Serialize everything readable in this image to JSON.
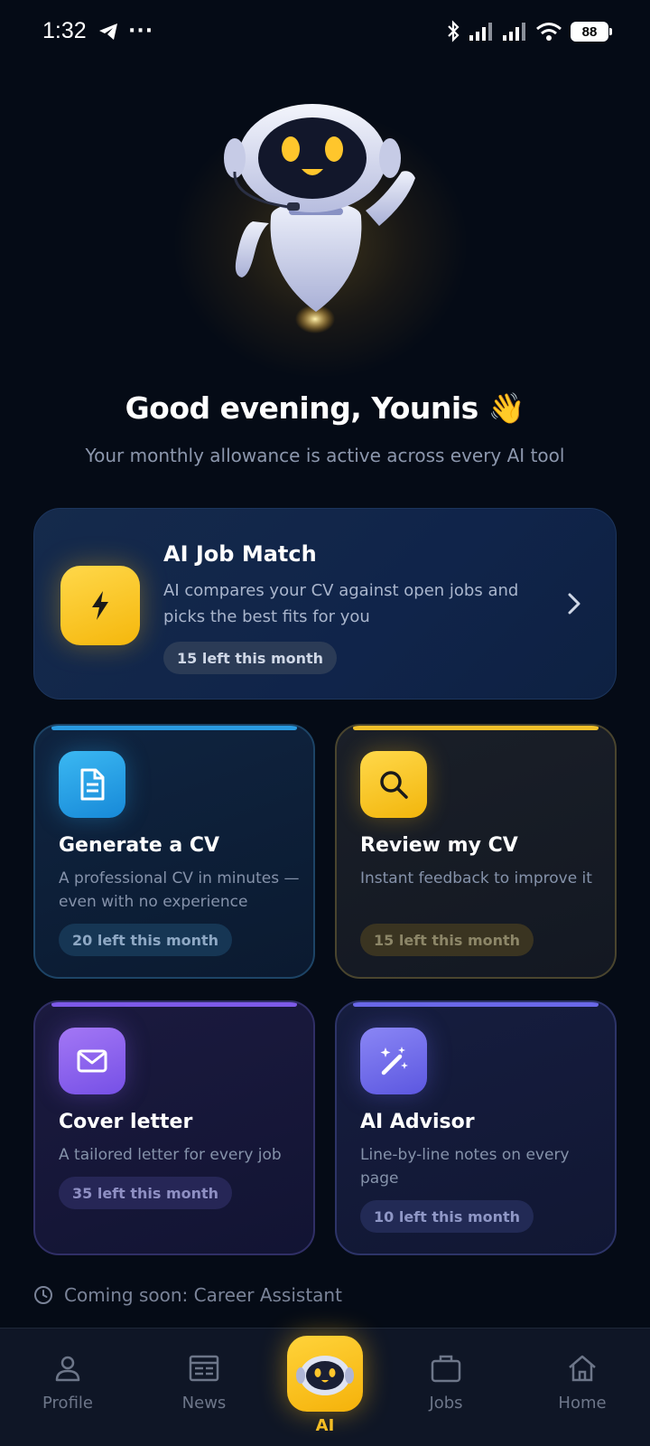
{
  "status_bar": {
    "time": "1:32",
    "more": "···",
    "battery": "88"
  },
  "hero": {
    "greeting": "Good evening, Younis 👋",
    "subtitle": "Your monthly allowance is active across every AI tool"
  },
  "featured": {
    "title": "AI Job Match",
    "description": "AI compares your CV against open jobs and picks the best fits for you",
    "badge": "15 left this month",
    "icon": "lightning-icon"
  },
  "tools": [
    {
      "title": "Generate a CV",
      "description": "A professional CV in minutes — even with no experience",
      "badge": "20 left this month",
      "icon": "document-icon",
      "color": "#2a9ae0"
    },
    {
      "title": "Review my CV",
      "description": "Instant feedback to improve it",
      "badge": "15 left this month",
      "icon": "search-icon",
      "color": "#f1c02a"
    },
    {
      "title": "Cover letter",
      "description": "A tailored letter for every job",
      "badge": "35 left this month",
      "icon": "envelope-icon",
      "color": "#7d5ae8"
    },
    {
      "title": "AI Advisor",
      "description": "Line-by-line notes on every page",
      "badge": "10 left this month",
      "icon": "magic-wand-icon",
      "color": "#6a68e8"
    }
  ],
  "coming_soon": "Coming soon: Career Assistant",
  "nav": {
    "profile": "Profile",
    "news": "News",
    "ai": "AI",
    "jobs": "Jobs",
    "home": "Home"
  },
  "colors": {
    "accent": "#f5be24",
    "background": "#050b16"
  }
}
